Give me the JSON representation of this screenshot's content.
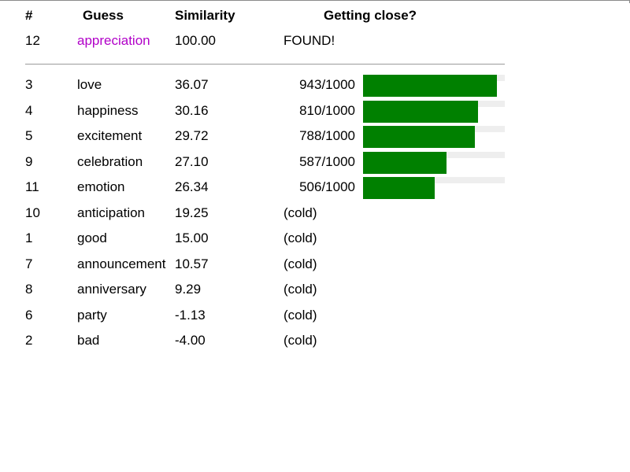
{
  "colors": {
    "found_word": "#b100c8",
    "bar_fill": "#008000",
    "bar_track": "#eeeeee"
  },
  "header": {
    "num": "#",
    "guess": "Guess",
    "similarity": "Similarity",
    "getting_close": "Getting close?"
  },
  "found_row": {
    "num": "12",
    "guess": "appreciation",
    "similarity": "100.00",
    "status": "FOUND!"
  },
  "guesses": [
    {
      "num": "3",
      "guess": "love",
      "similarity": "36.07",
      "score_text": "943/1000",
      "proximity": 943
    },
    {
      "num": "4",
      "guess": "happiness",
      "similarity": "30.16",
      "score_text": "810/1000",
      "proximity": 810
    },
    {
      "num": "5",
      "guess": "excitement",
      "similarity": "29.72",
      "score_text": "788/1000",
      "proximity": 788
    },
    {
      "num": "9",
      "guess": "celebration",
      "similarity": "27.10",
      "score_text": "587/1000",
      "proximity": 587
    },
    {
      "num": "11",
      "guess": "emotion",
      "similarity": "26.34",
      "score_text": "506/1000",
      "proximity": 506
    },
    {
      "num": "10",
      "guess": "anticipation",
      "similarity": "19.25",
      "status": "(cold)"
    },
    {
      "num": "1",
      "guess": "good",
      "similarity": "15.00",
      "status": "(cold)"
    },
    {
      "num": "7",
      "guess": "announcement",
      "similarity": "10.57",
      "status": "(cold)"
    },
    {
      "num": "8",
      "guess": "anniversary",
      "similarity": "9.29",
      "status": "(cold)"
    },
    {
      "num": "6",
      "guess": "party",
      "similarity": "-1.13",
      "status": "(cold)"
    },
    {
      "num": "2",
      "guess": "bad",
      "similarity": "-4.00",
      "status": "(cold)"
    }
  ]
}
